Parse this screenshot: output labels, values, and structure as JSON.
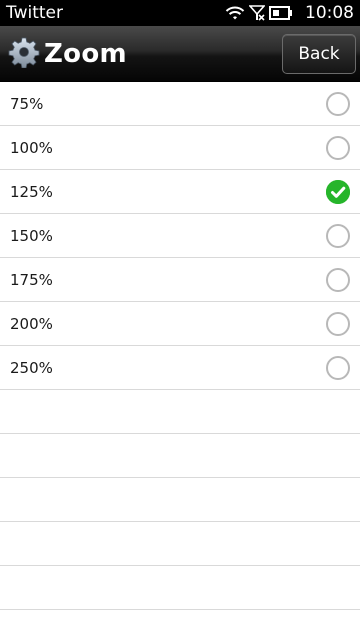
{
  "status_bar": {
    "app_name": "Twitter",
    "time": "10:08",
    "icons": [
      "wifi-icon",
      "signal-no-service-icon",
      "battery-icon"
    ]
  },
  "header": {
    "icon": "gear-icon",
    "title": "Zoom",
    "back_label": "Back"
  },
  "zoom_options": [
    {
      "label": "75%",
      "selected": false
    },
    {
      "label": "100%",
      "selected": false
    },
    {
      "label": "125%",
      "selected": true
    },
    {
      "label": "150%",
      "selected": false
    },
    {
      "label": "175%",
      "selected": false
    },
    {
      "label": "200%",
      "selected": false
    },
    {
      "label": "250%",
      "selected": false
    }
  ],
  "colors": {
    "selected_check": "#26b52b",
    "unselected_ring": "#b8b8b8",
    "divider": "#d9d9d9"
  }
}
